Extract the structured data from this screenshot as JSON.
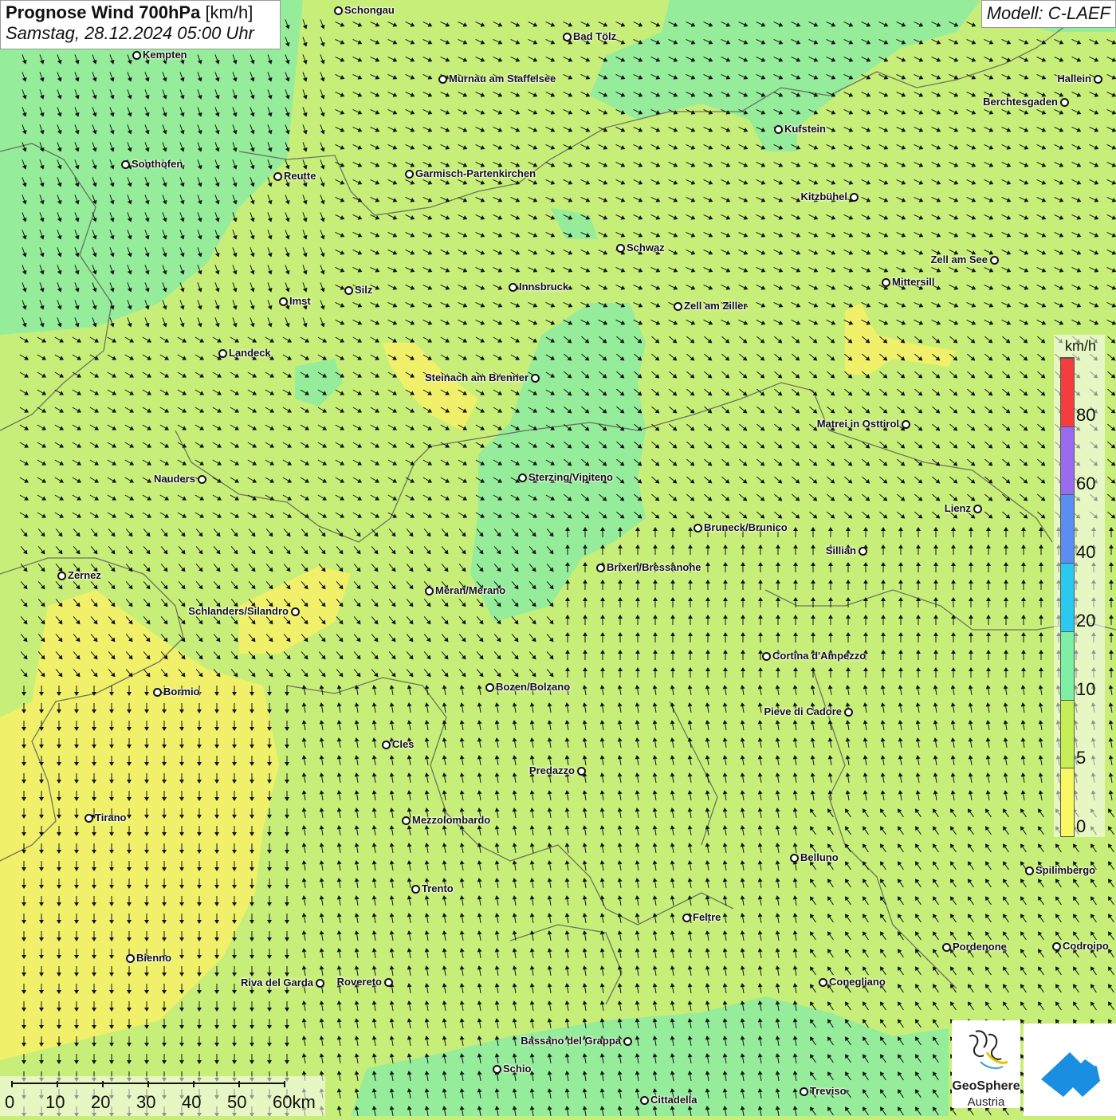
{
  "title": {
    "parameter": "Prognose Wind 700hPa",
    "unit": "[km/h]",
    "datetime": "Samstag, 28.12.2024 05:00 Uhr"
  },
  "model": "Modell: C-LAEF",
  "legend": {
    "unit": "km/h",
    "stops": [
      {
        "label": "0",
        "color": "#fbf763"
      },
      {
        "label": "5",
        "color": "#c6ef55"
      },
      {
        "label": "10",
        "color": "#7ef0a4"
      },
      {
        "label": "20",
        "color": "#2bc8f0"
      },
      {
        "label": "40",
        "color": "#5a8ef0"
      },
      {
        "label": "60",
        "color": "#9a6bef"
      },
      {
        "label": "80",
        "color": "#f53d3d"
      }
    ]
  },
  "cities": [
    {
      "name": "Schongau"
    },
    {
      "name": "Bad Tölz"
    },
    {
      "name": "Kempten"
    },
    {
      "name": "Murnau am Staffelsee"
    },
    {
      "name": "Hallein"
    },
    {
      "name": "Berchtesgaden"
    },
    {
      "name": "Kufstein"
    },
    {
      "name": "Sonthofen"
    },
    {
      "name": "Reutte"
    },
    {
      "name": "Garmisch-Partenkirchen"
    },
    {
      "name": "Kitzbühel"
    },
    {
      "name": "Schwaz"
    },
    {
      "name": "Zell am See"
    },
    {
      "name": "Mittersill"
    },
    {
      "name": "Innsbruck"
    },
    {
      "name": "Silz"
    },
    {
      "name": "Imst"
    },
    {
      "name": "Zell am Ziller"
    },
    {
      "name": "Landeck"
    },
    {
      "name": "Steinach am Brenner"
    },
    {
      "name": "Matrei in Osttirol"
    },
    {
      "name": "Nauders"
    },
    {
      "name": "Sterzing/Vipiteno"
    },
    {
      "name": "Lienz"
    },
    {
      "name": "Bruneck/Brunico"
    },
    {
      "name": "Sillian"
    },
    {
      "name": "Zernez"
    },
    {
      "name": "Brixen/Bressanone"
    },
    {
      "name": "Meran/Merano"
    },
    {
      "name": "Schlanders/Silandro"
    },
    {
      "name": "Cortina d'Ampezzo"
    },
    {
      "name": "Bozen/Bolzano"
    },
    {
      "name": "Bormio"
    },
    {
      "name": "Pieve di Cadore"
    },
    {
      "name": "Cles"
    },
    {
      "name": "Predazzo"
    },
    {
      "name": "Tirano"
    },
    {
      "name": "Mezzolombardo"
    },
    {
      "name": "Belluno"
    },
    {
      "name": "Spilimbergo"
    },
    {
      "name": "Trento"
    },
    {
      "name": "Feltre"
    },
    {
      "name": "Pordenone"
    },
    {
      "name": "Codroipo"
    },
    {
      "name": "Bienno"
    },
    {
      "name": "Riva del Garda"
    },
    {
      "name": "Rovereto"
    },
    {
      "name": "Conegliano"
    },
    {
      "name": "Bassano del Grappa"
    },
    {
      "name": "Schio"
    },
    {
      "name": "Treviso"
    },
    {
      "name": "Cittadella"
    }
  ],
  "scale": {
    "labels": [
      "0",
      "10",
      "20",
      "30",
      "40",
      "50",
      "60km"
    ]
  },
  "logos": {
    "geosphere_line1": "GeoSphere",
    "geosphere_line2": "Austria"
  },
  "wind": {
    "direction_note_deg": "varies by region",
    "zones": [
      {
        "region": "north-west",
        "direction_deg": 135
      },
      {
        "region": "north-central",
        "direction_deg": 120
      },
      {
        "region": "central",
        "direction_deg": 160
      },
      {
        "region": "south",
        "direction_deg": 0
      },
      {
        "region": "south-east",
        "direction_deg": 330
      }
    ]
  }
}
